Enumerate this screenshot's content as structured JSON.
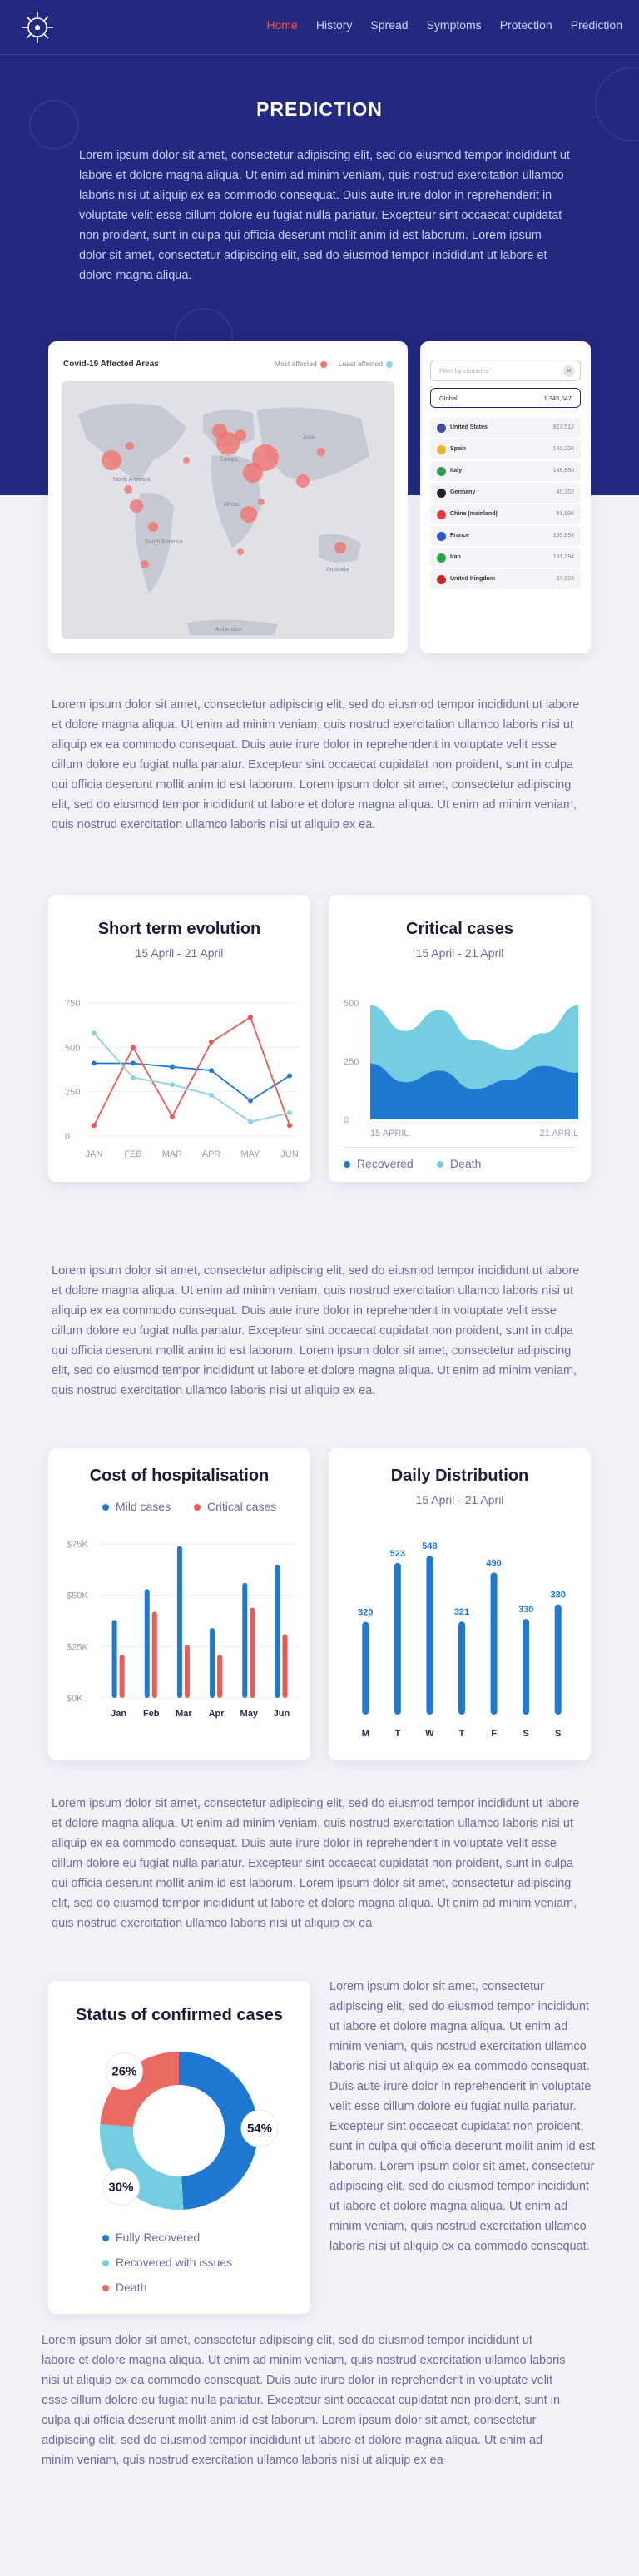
{
  "nav": {
    "items": [
      {
        "label": "Home",
        "active": true
      },
      {
        "label": "History",
        "active": false
      },
      {
        "label": "Spread",
        "active": false
      },
      {
        "label": "Symptoms",
        "active": false
      },
      {
        "label": "Protection",
        "active": false
      },
      {
        "label": "Prediction",
        "active": false
      }
    ]
  },
  "page": {
    "title": "PREDICTION",
    "intro": "Lorem ipsum dolor sit amet, consectetur adipiscing elit, sed do eiusmod tempor incididunt ut labore et dolore magna aliqua. Ut enim ad minim veniam, quis nostrud exercitation ullamco laboris nisi ut aliquip ex ea commodo consequat. Duis aute irure dolor in reprehenderit in voluptate velit esse cillum dolore eu fugiat nulla pariatur. Excepteur sint occaecat cupidatat non proident, sunt in culpa qui officia deserunt mollit anim id est laborum. Lorem ipsum dolor sit amet, consectetur adipiscing elit, sed do eiusmod tempor incididunt ut labore et dolore magna aliqua."
  },
  "map": {
    "title": "Covid-19 Affected Areas",
    "legend_most": "Most affected",
    "legend_least": "Least affected",
    "colors": {
      "most": "#f0736e",
      "least": "#8fd0e6"
    },
    "region_labels": [
      "North America",
      "South America",
      "Europe",
      "Africa",
      "Asia",
      "Australia",
      "Antarctica"
    ]
  },
  "countries": {
    "search_placeholder": "Filter by countries",
    "global_label": "Global",
    "global_value": "1,345,047",
    "list": [
      {
        "name": "United States",
        "value": "823,512",
        "color": "#3c4fa0"
      },
      {
        "name": "Spain",
        "value": "148,220",
        "color": "#f2b12c"
      },
      {
        "name": "Italy",
        "value": "148,880",
        "color": "#2e9e4f"
      },
      {
        "name": "Germany",
        "value": "45,302",
        "color": "#222222"
      },
      {
        "name": "China (mainland)",
        "value": "81,890",
        "color": "#e53935"
      },
      {
        "name": "France",
        "value": "139,893",
        "color": "#2f58c7"
      },
      {
        "name": "Iran",
        "value": "131,294",
        "color": "#28a745"
      },
      {
        "name": "United Kingdom",
        "value": "97,903",
        "color": "#c62828"
      }
    ]
  },
  "paragraphs": {
    "p1": "Lorem ipsum dolor sit amet, consectetur adipiscing elit, sed do eiusmod tempor incididunt ut labore et dolore magna aliqua. Ut enim ad minim veniam, quis nostrud exercitation ullamco laboris nisi ut aliquip ex ea commodo consequat. Duis aute irure dolor in reprehenderit in voluptate velit esse cillum dolore eu fugiat nulla pariatur. Excepteur sint occaecat cupidatat non proident, sunt in culpa qui officia deserunt mollit anim id est laborum. Lorem ipsum dolor sit amet, consectetur adipiscing elit, sed do eiusmod tempor incididunt ut labore et dolore magna aliqua. Ut enim ad minim veniam, quis nostrud exercitation ullamco laboris nisi ut aliquip ex ea.",
    "p2": "Lorem ipsum dolor sit amet, consectetur adipiscing elit, sed do eiusmod tempor incididunt ut labore et dolore magna aliqua. Ut enim ad minim veniam, quis nostrud exercitation ullamco laboris nisi ut aliquip ex ea commodo consequat. Duis aute irure dolor in reprehenderit in voluptate velit esse cillum dolore eu fugiat nulla pariatur. Excepteur sint occaecat cupidatat non proident, sunt in culpa qui officia deserunt mollit anim id est laborum. Lorem ipsum dolor sit amet, consectetur adipiscing elit, sed do eiusmod tempor incididunt ut labore et dolore magna aliqua. Ut enim ad minim veniam, quis nostrud exercitation ullamco laboris nisi ut aliquip ex ea.",
    "p3": "Lorem ipsum dolor sit amet, consectetur adipiscing elit, sed do eiusmod tempor incididunt ut labore et dolore magna aliqua. Ut enim ad minim veniam, quis nostrud exercitation ullamco laboris nisi ut aliquip ex ea commodo consequat. Duis aute irure dolor in reprehenderit in voluptate velit esse cillum dolore eu fugiat nulla pariatur. Excepteur sint occaecat cupidatat non proident, sunt in culpa qui officia deserunt mollit anim id est laborum. Lorem ipsum dolor sit amet, consectetur adipiscing elit, sed do eiusmod tempor incididunt ut labore et dolore magna aliqua. Ut enim ad minim veniam, quis nostrud exercitation ullamco laboris nisi ut aliquip ex ea",
    "side": "Lorem ipsum dolor sit amet, consectetur adipiscing elit, sed do eiusmod tempor incididunt ut labore et dolore magna aliqua. Ut enim ad minim veniam, quis nostrud exercitation ullamco laboris nisi ut aliquip ex ea commodo consequat. Duis aute irure dolor in reprehenderit in voluptate velit esse cillum dolore eu fugiat nulla pariatur. Excepteur sint occaecat cupidatat non proident, sunt in culpa qui officia deserunt mollit anim id est laborum. Lorem ipsum dolor sit amet, consectetur adipiscing elit, sed do eiusmod tempor incididunt ut labore et dolore magna aliqua. Ut enim ad minim veniam, quis nostrud exercitation ullamco laboris nisi ut aliquip ex ea commodo consequat.",
    "p4": "Lorem ipsum dolor sit amet, consectetur adipiscing elit, sed do eiusmod tempor incididunt ut labore et dolore magna aliqua. Ut enim ad minim veniam, quis nostrud exercitation ullamco laboris nisi ut aliquip ex ea commodo consequat. Duis aute irure dolor in reprehenderit in voluptate velit esse cillum dolore eu fugiat nulla pariatur. Excepteur sint occaecat cupidatat non proident, sunt in culpa qui officia deserunt mollit anim id est laborum. Lorem ipsum dolor sit amet, consectetur adipiscing elit, sed do eiusmod tempor incididunt ut labore et dolore magna aliqua. Ut enim ad minim veniam, quis nostrud exercitation ullamco laboris nisi ut aliquip ex ea"
  },
  "chart_data": [
    {
      "type": "line",
      "title": "Short term evolution",
      "subtitle": "15 April - 21 April",
      "categories": [
        "JAN",
        "FEB",
        "MAR",
        "APR",
        "MAY",
        "JUN"
      ],
      "ylim": [
        0,
        750
      ],
      "yticks": [
        0,
        250,
        500,
        750
      ],
      "grid": true,
      "series": [
        {
          "color": "#1f78d1",
          "values": [
            410,
            410,
            390,
            370,
            200,
            340
          ]
        },
        {
          "color": "#ec5a55",
          "values": [
            60,
            500,
            110,
            530,
            670,
            60
          ]
        },
        {
          "color": "#8bd0e6",
          "values": [
            580,
            330,
            290,
            230,
            80,
            130
          ]
        }
      ]
    },
    {
      "type": "area",
      "title": "Critical cases",
      "subtitle": "15 April - 21 April",
      "xlabels": [
        "15 APRIL",
        "21 APRIL"
      ],
      "ylim": [
        0,
        500
      ],
      "yticks": [
        0,
        250,
        500
      ],
      "series": [
        {
          "name": "Recovered",
          "color": "#1f78d1",
          "values": [
            240,
            160,
            210,
            130,
            170,
            230,
            200
          ]
        },
        {
          "name": "Death",
          "color": "#74cde0",
          "values": [
            490,
            380,
            470,
            340,
            300,
            370,
            490
          ]
        }
      ]
    },
    {
      "type": "bar",
      "title": "Cost of hospitalisation",
      "categories": [
        "Jan",
        "Feb",
        "Mar",
        "Apr",
        "May",
        "Jun"
      ],
      "ylim": [
        0,
        75
      ],
      "yticks": [
        "$0K",
        "$25K",
        "$50K",
        "$75K"
      ],
      "series": [
        {
          "name": "Mild cases",
          "color": "#1f78d1",
          "values": [
            38,
            53,
            74,
            34,
            56,
            65
          ]
        },
        {
          "name": "Critical cases",
          "color": "#ec5a55",
          "values": [
            21,
            42,
            26,
            21,
            44,
            31
          ]
        }
      ]
    },
    {
      "type": "bar",
      "title": "Daily Distribution",
      "subtitle": "15 April - 21 April",
      "categories": [
        "M",
        "T",
        "W",
        "T",
        "F",
        "S",
        "S"
      ],
      "values": [
        320,
        523,
        548,
        321,
        490,
        330,
        380
      ],
      "color": "#1f78d1"
    },
    {
      "type": "pie",
      "title": "Status of confirmed cases",
      "slices": [
        {
          "name": "Fully Recovered",
          "value": 54,
          "label": "54%",
          "color": "#1f78d1"
        },
        {
          "name": "Recovered with issues",
          "value": 30,
          "label": "30%",
          "color": "#74cde0"
        },
        {
          "name": "Death",
          "value": 26,
          "label": "26%",
          "color": "#ec6a64"
        }
      ]
    }
  ]
}
